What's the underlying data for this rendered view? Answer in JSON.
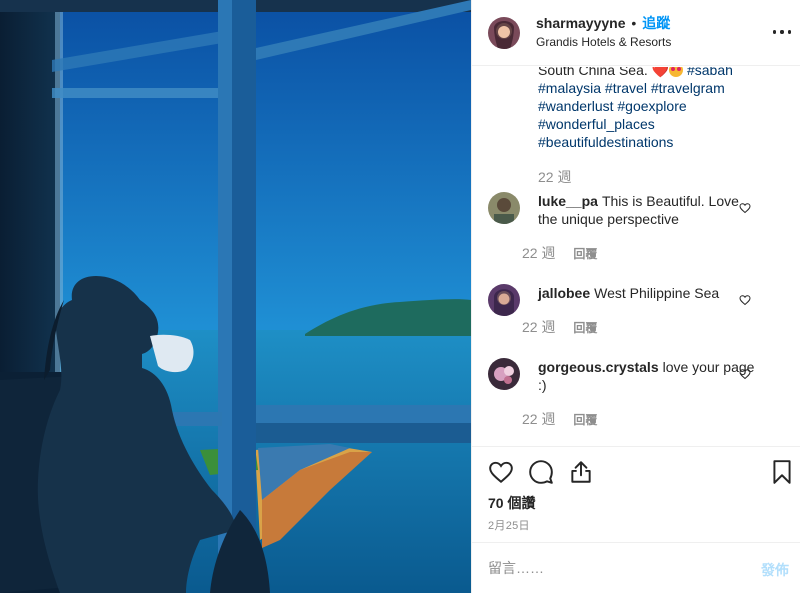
{
  "header": {
    "username": "sharmayyyne",
    "dot": "•",
    "follow_label": "追蹤",
    "location": "Grandis Hotels & Resorts",
    "avatar_icon": "profile-photo",
    "more_icon": "more-options-icon"
  },
  "caption": {
    "text_start": "South China Sea. ",
    "heart_emoji": "❤️",
    "hashtags": "#sabah #malaysia #travel #travelgram #wanderlust #goexplore #wonderful_places #beautifuldestinations",
    "time": "22 週"
  },
  "comments": [
    {
      "user": "luke__pa",
      "text": "This is Beautiful. Love the unique perspective",
      "time": "22 週",
      "reply": "回覆"
    },
    {
      "user": "jallobee",
      "text": "West Philippine Sea",
      "time": "22 週",
      "reply": "回覆"
    },
    {
      "user": "gorgeous.crystals",
      "text": "love your page :)",
      "time": "22 週",
      "reply": "回覆"
    }
  ],
  "actions": {
    "like_icon": "heart-icon",
    "comment_icon": "comment-icon",
    "share_icon": "share-icon",
    "save_icon": "bookmark-icon",
    "likes_count": "70 個讚",
    "date": "2月25日"
  },
  "comment_box": {
    "placeholder": "留言……",
    "post_label": "發佈"
  },
  "colors": {
    "link": "#00376b",
    "follow": "#0095f6",
    "muted": "#8e8e8e",
    "post_disabled": "#b2dffc"
  }
}
